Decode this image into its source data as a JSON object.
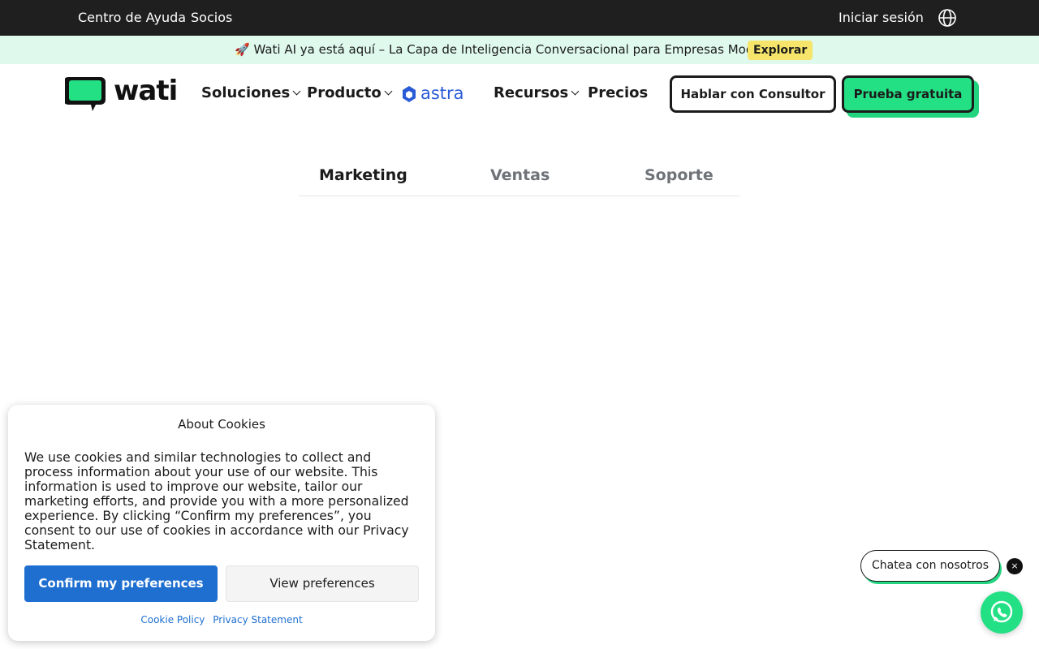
{
  "topbar": {
    "help_center": "Centro de Ayuda",
    "partners": "Socios",
    "login": "Iniciar sesión",
    "globe_icon": "globe-icon"
  },
  "announcement": {
    "emoji": "🚀",
    "message": "Wati AI ya está aquí – La Capa de Inteligencia Conversacional para Empresas Modernas",
    "cta": "Explorar"
  },
  "header": {
    "logo_text": "wati",
    "nav": {
      "solutions": "Soluciones",
      "product": "Producto",
      "astra": "astra",
      "resources": "Recursos",
      "pricing": "Precios"
    },
    "consult_button": "Hablar con Consultor",
    "trial_button": "Prueba gratuita"
  },
  "tabs": [
    {
      "label": "Marketing",
      "active": true
    },
    {
      "label": "Ventas",
      "active": false
    },
    {
      "label": "Soporte",
      "active": false
    }
  ],
  "cookie_banner": {
    "title": "About Cookies",
    "body": "We use cookies and similar technologies to collect and process information about your use of our website. This information is used to improve our website, tailor our marketing efforts, and provide you with a more personalized experience. By clicking “Confirm my preferences”, you consent to our use of cookies in accordance with our Privacy Statement.",
    "confirm_button": "Confirm my preferences",
    "view_button": "View preferences",
    "cookie_policy_link": "Cookie Policy",
    "privacy_link": "Privacy Statement"
  },
  "chat_widget": {
    "label": "Chatea con nosotros",
    "close": "×"
  },
  "colors": {
    "brand_green": "#23e085",
    "topbar_bg": "#1f1f1f",
    "announce_bg": "#dff9ed",
    "cookie_blue": "#1f6fd0"
  }
}
